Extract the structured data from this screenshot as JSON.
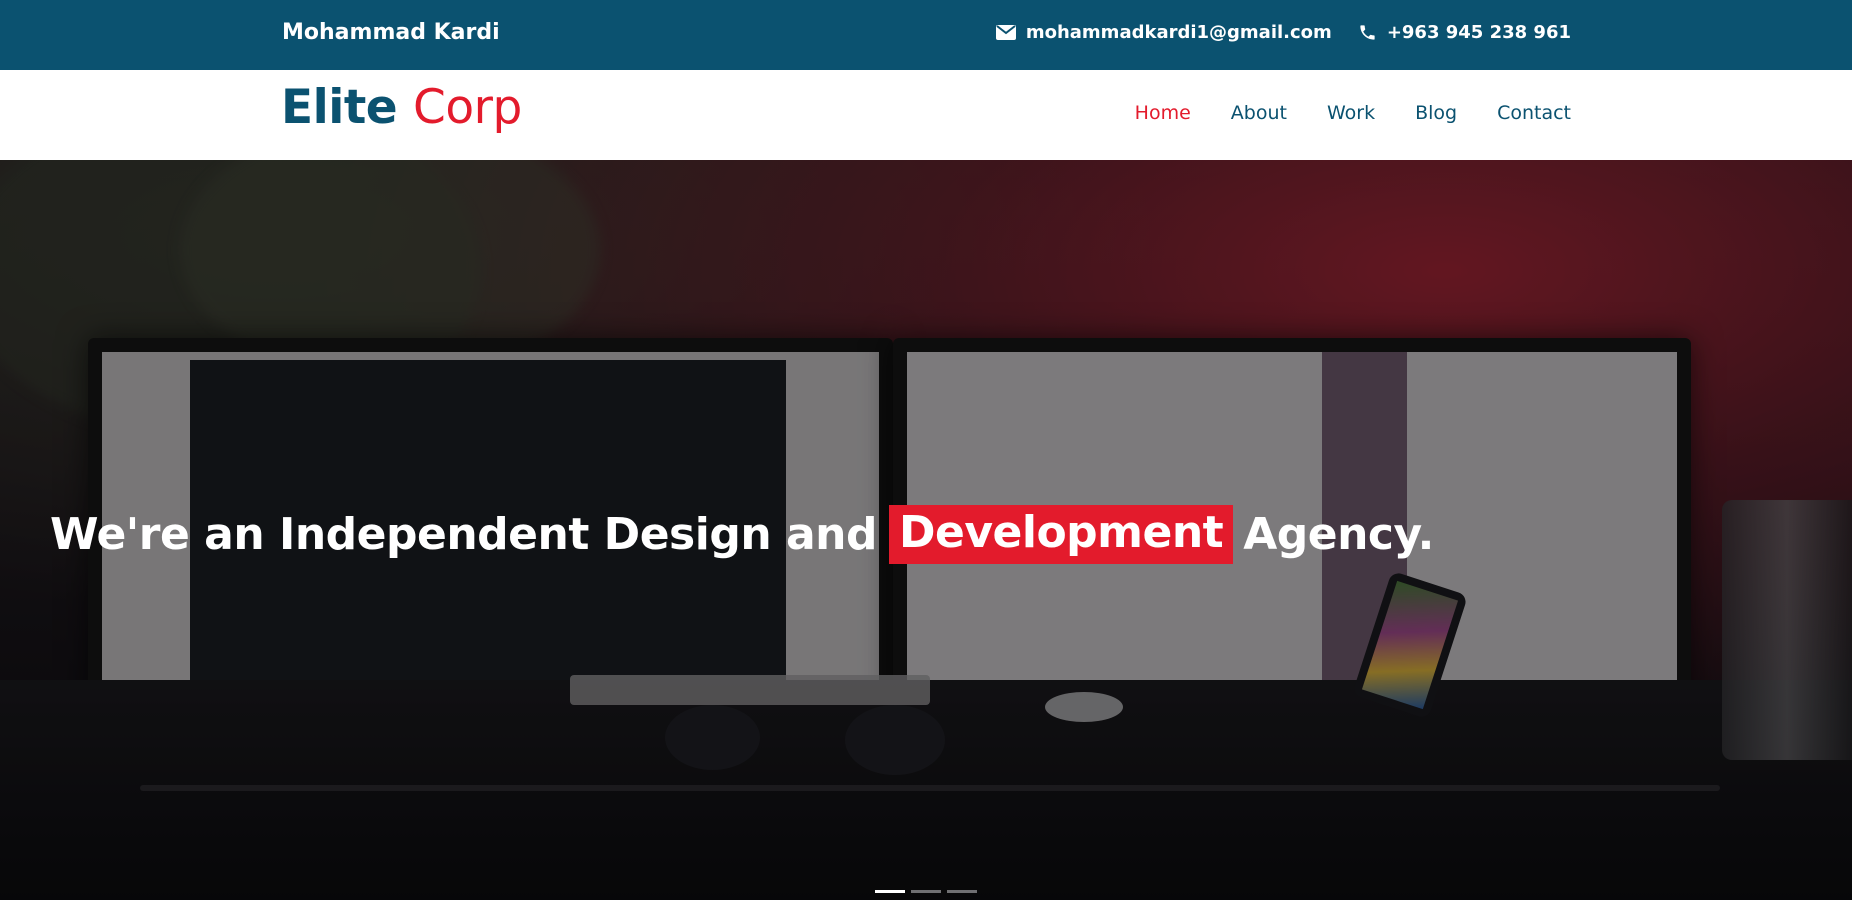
{
  "topbar": {
    "owner_name": "Mohammad Kardi",
    "email": "mohammadkardi1@gmail.com",
    "phone": "+963 945 238 961",
    "email_icon": "envelope-icon",
    "phone_icon": "phone-icon"
  },
  "header": {
    "logo_part1": "Elite",
    "logo_part2": "Corp",
    "nav": [
      {
        "label": "Home",
        "active": true
      },
      {
        "label": "About",
        "active": false
      },
      {
        "label": "Work",
        "active": false
      },
      {
        "label": "Blog",
        "active": false
      },
      {
        "label": "Contact",
        "active": false
      }
    ]
  },
  "hero": {
    "headline_before": "We're an Independent Design and",
    "headline_highlight": "Development",
    "headline_after": "Agency.",
    "slides_count": 3,
    "active_slide": 1
  },
  "colors": {
    "brand_dark": "#0b5270",
    "accent_red": "#e31b2c",
    "white": "#ffffff"
  }
}
